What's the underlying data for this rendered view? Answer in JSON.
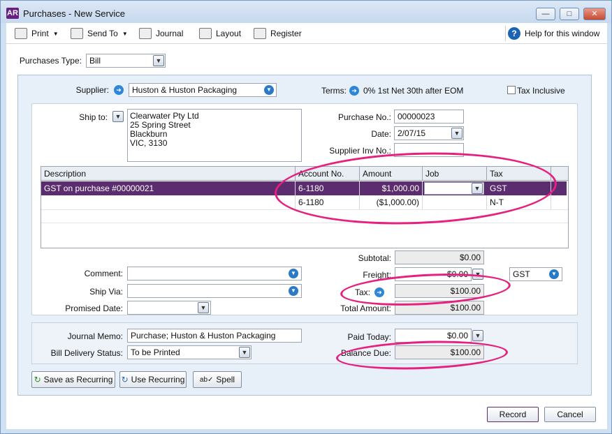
{
  "window": {
    "title": "Purchases - New Service",
    "logo": "AR"
  },
  "toolbar": {
    "print": "Print",
    "send_to": "Send To",
    "journal": "Journal",
    "layout": "Layout",
    "register": "Register",
    "help": "Help for this window"
  },
  "purchase_type": {
    "label": "Purchases Type:",
    "value": "Bill"
  },
  "supplier": {
    "label": "Supplier:",
    "value": "Huston & Huston Packaging"
  },
  "terms": {
    "label": "Terms:",
    "value": "0% 1st Net 30th after EOM"
  },
  "tax_inclusive": {
    "label": "Tax Inclusive",
    "checked": false
  },
  "ship_to": {
    "label": "Ship to:",
    "lines": [
      "Clearwater Pty Ltd",
      "25 Spring Street",
      "Blackburn",
      "VIC, 3130"
    ]
  },
  "purchase_no": {
    "label": "Purchase No.:",
    "value": "00000023"
  },
  "date": {
    "label": "Date:",
    "value": "2/07/15"
  },
  "supplier_inv": {
    "label": "Supplier Inv No.:",
    "value": ""
  },
  "grid": {
    "headers": [
      "Description",
      "Account No.",
      "Amount",
      "Job",
      "Tax"
    ],
    "rows": [
      {
        "description": "GST on purchase #00000021",
        "account": "6-1180",
        "amount": "$1,000.00",
        "job": "",
        "tax": "GST"
      },
      {
        "description": "",
        "account": "6-1180",
        "amount": "($1,000.00)",
        "job": "",
        "tax": "N-T"
      }
    ]
  },
  "totals": {
    "subtotal_label": "Subtotal:",
    "subtotal": "$0.00",
    "freight_label": "Freight:",
    "freight": "$0.00",
    "freight_tax": "GST",
    "tax_label": "Tax:",
    "tax": "$100.00",
    "total_label": "Total Amount:",
    "total": "$100.00"
  },
  "comment": {
    "label": "Comment:",
    "value": ""
  },
  "ship_via": {
    "label": "Ship Via:",
    "value": ""
  },
  "promised_date": {
    "label": "Promised Date:",
    "value": ""
  },
  "journal_memo": {
    "label": "Journal Memo:",
    "value": "Purchase; Huston & Huston Packaging"
  },
  "bill_delivery": {
    "label": "Bill Delivery Status:",
    "value": "To be Printed"
  },
  "paid_today": {
    "label": "Paid Today:",
    "value": "$0.00"
  },
  "balance_due": {
    "label": "Balance Due:",
    "value": "$100.00"
  },
  "buttons": {
    "save_recurring": "Save as Recurring",
    "use_recurring": "Use Recurring",
    "spell": "Spell",
    "record": "Record",
    "cancel": "Cancel"
  },
  "colors": {
    "selection": "#5b2d6e",
    "annotation": "#e6207e",
    "accent": "#2a7ac7"
  }
}
